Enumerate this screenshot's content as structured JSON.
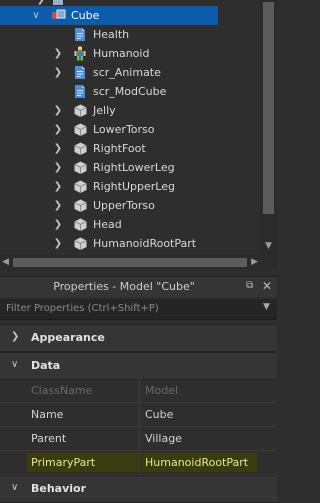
{
  "explorer": {
    "items": [
      {
        "label": "Cube",
        "icon": "model-icon",
        "expand": "open",
        "selected": true,
        "indent": 0
      },
      {
        "label": "Health",
        "icon": "script-icon",
        "expand": "none",
        "selected": false,
        "indent": 1
      },
      {
        "label": "Humanoid",
        "icon": "humanoid-icon",
        "expand": "closed",
        "selected": false,
        "indent": 1
      },
      {
        "label": "scr_Animate",
        "icon": "script-icon",
        "expand": "closed",
        "selected": false,
        "indent": 1
      },
      {
        "label": "scr_ModCube",
        "icon": "script-icon",
        "expand": "none",
        "selected": false,
        "indent": 1
      },
      {
        "label": "Jelly",
        "icon": "part-icon",
        "expand": "closed",
        "selected": false,
        "indent": 1
      },
      {
        "label": "LowerTorso",
        "icon": "part-icon",
        "expand": "closed",
        "selected": false,
        "indent": 1
      },
      {
        "label": "RightFoot",
        "icon": "part-icon",
        "expand": "closed",
        "selected": false,
        "indent": 1
      },
      {
        "label": "RightLowerLeg",
        "icon": "part-icon",
        "expand": "closed",
        "selected": false,
        "indent": 1
      },
      {
        "label": "RightUpperLeg",
        "icon": "part-icon",
        "expand": "closed",
        "selected": false,
        "indent": 1
      },
      {
        "label": "UpperTorso",
        "icon": "part-icon",
        "expand": "closed",
        "selected": false,
        "indent": 1
      },
      {
        "label": "Head",
        "icon": "part-icon",
        "expand": "closed",
        "selected": false,
        "indent": 1
      },
      {
        "label": "HumanoidRootPart",
        "icon": "part-icon",
        "expand": "closed",
        "selected": false,
        "indent": 1
      }
    ]
  },
  "properties": {
    "title": "Properties - Model \"Cube\"",
    "filter_placeholder": "Filter Properties (Ctrl+Shift+P)",
    "sections": {
      "appearance": "Appearance",
      "data": "Data",
      "behavior": "Behavior"
    },
    "rows": [
      {
        "name": "ClassName",
        "value": "Model",
        "readonly": true,
        "highlight": false
      },
      {
        "name": "Name",
        "value": "Cube",
        "readonly": false,
        "highlight": false
      },
      {
        "name": "Parent",
        "value": "Village",
        "readonly": false,
        "highlight": false
      },
      {
        "name": "PrimaryPart",
        "value": "HumanoidRootPart",
        "readonly": false,
        "highlight": true
      }
    ]
  },
  "colors": {
    "selection": "#0b5cad",
    "highlight_bg": "#3b3b10",
    "highlight_text": "#e6e69a"
  }
}
